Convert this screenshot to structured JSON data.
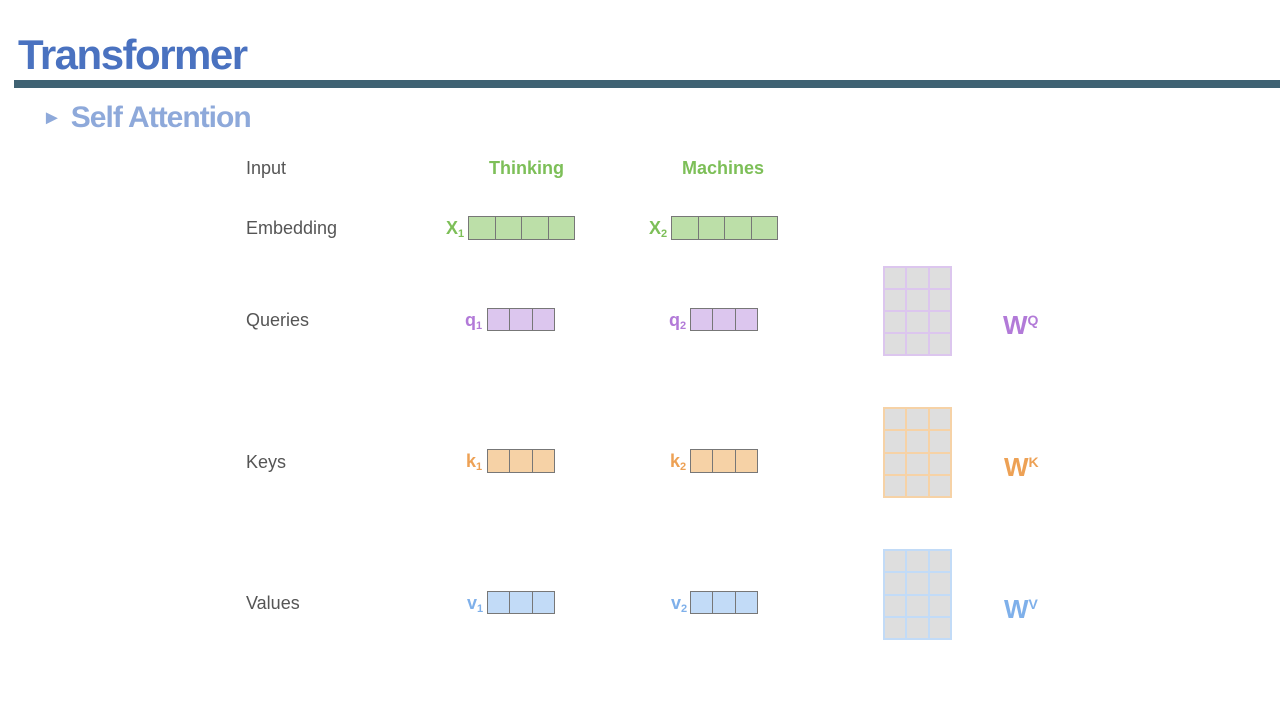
{
  "title": "Transformer",
  "subtitle": {
    "bullet": "►",
    "text": "Self Attention"
  },
  "rows": {
    "input": "Input",
    "embedding": "Embedding",
    "queries": "Queries",
    "keys": "Keys",
    "values": "Values"
  },
  "words": [
    "Thinking",
    "Machines"
  ],
  "vectors": {
    "x1": {
      "base": "X",
      "sub": "1"
    },
    "x2": {
      "base": "X",
      "sub": "2"
    },
    "q1": {
      "base": "q",
      "sub": "1"
    },
    "q2": {
      "base": "q",
      "sub": "2"
    },
    "k1": {
      "base": "k",
      "sub": "1"
    },
    "k2": {
      "base": "k",
      "sub": "2"
    },
    "v1": {
      "base": "v",
      "sub": "1"
    },
    "v2": {
      "base": "v",
      "sub": "2"
    }
  },
  "weights": {
    "wq": {
      "base": "W",
      "sup": "Q"
    },
    "wk": {
      "base": "W",
      "sup": "K"
    },
    "wv": {
      "base": "W",
      "sup": "V"
    }
  },
  "colors": {
    "title": "#4a72c0",
    "rule": "#3f6273",
    "subtitle": "#8ea9da",
    "embedding_fill": "#bcdfa8",
    "embedding_text": "#7dbf58",
    "query_fill": "#dcc6ee",
    "query_text": "#b27ad8",
    "key_fill": "#f6d2a6",
    "key_text": "#eda155",
    "value_fill": "#c2dbf7",
    "value_text": "#7fb0ea",
    "matrix_cell": "#dedede"
  }
}
